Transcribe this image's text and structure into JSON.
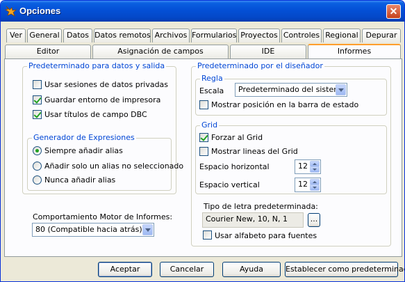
{
  "window": {
    "title": "Opciones"
  },
  "tabs_row1": [
    {
      "label": "Ver"
    },
    {
      "label": "General"
    },
    {
      "label": "Datos"
    },
    {
      "label": "Datos remotos"
    },
    {
      "label": "Archivos"
    },
    {
      "label": "Formularios"
    },
    {
      "label": "Proyectos"
    },
    {
      "label": "Controles"
    },
    {
      "label": "Regional"
    },
    {
      "label": "Depurar"
    }
  ],
  "tabs_row2": [
    {
      "label": "Editor"
    },
    {
      "label": "Asignación de campos"
    },
    {
      "label": "IDE"
    },
    {
      "label": "Informes",
      "active": true
    }
  ],
  "left": {
    "group_title": "Predeterminado para datos y salida",
    "private_sessions": {
      "label": "Usar sesiones de datos privadas",
      "checked": false
    },
    "save_printer": {
      "label": "Guardar entorno de impresora",
      "checked": true
    },
    "dbc_titles": {
      "label": "Usar títulos de campo DBC",
      "checked": true
    },
    "expr_gen": {
      "title": "Generador de Expresiones",
      "options": [
        {
          "label": "Siempre añadir alias",
          "selected": true
        },
        {
          "label": "Añadir solo un alias no seleccionado",
          "selected": false
        },
        {
          "label": "Nunca añadir alias",
          "selected": false
        }
      ]
    },
    "engine_label": "Comportamiento Motor de Informes:",
    "engine_value": "80 (Compatible hacia atrás)"
  },
  "right": {
    "group_title": "Predeterminado por el diseñador",
    "regla": {
      "title": "Regla",
      "scale_label": "Escala",
      "scale_value": "Predeterminado del sistema",
      "show_position": {
        "label": "Mostrar posición en la barra de estado",
        "checked": false
      }
    },
    "grid": {
      "title": "Grid",
      "snap": {
        "label": "Forzar al Grid",
        "checked": true
      },
      "show_lines": {
        "label": "Mostrar lineas del Grid",
        "checked": false
      },
      "h_label": "Espacio horizontal",
      "h_value": "12",
      "v_label": "Espacio vertical",
      "v_value": "12"
    },
    "font_label": "Tipo de letra predeterminada:",
    "font_value": "Courier New, 10, N, 1",
    "font_button": "...",
    "alphabet": {
      "label": "Usar alfabeto para fuentes",
      "checked": false
    }
  },
  "buttons": {
    "ok": "Aceptar",
    "cancel": "Cancelar",
    "help": "Ayuda",
    "set_default": "Establecer como predeterminado"
  },
  "colors": {
    "title_bar": "#0450d6",
    "group_title": "#0046d5",
    "active_tab_accent": "#ff9e2c",
    "check_mark": "#21a121"
  }
}
